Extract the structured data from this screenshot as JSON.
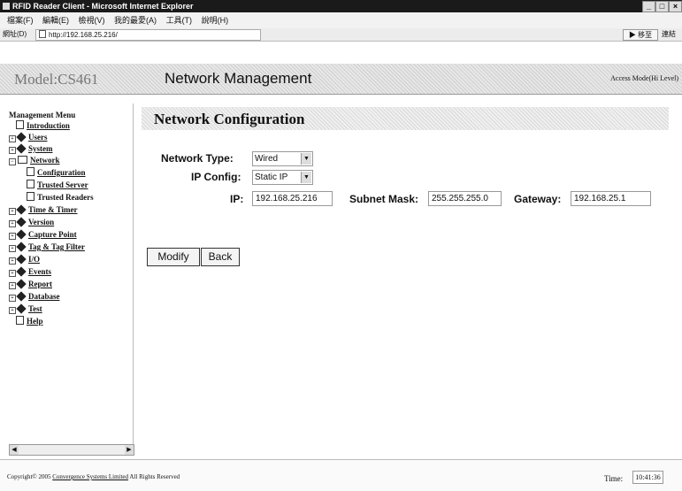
{
  "window": {
    "title": "RFID Reader Client - Microsoft Internet Explorer"
  },
  "menu": {
    "items": [
      "檔案(F)",
      "編輯(E)",
      "檢視(V)",
      "我的最愛(A)",
      "工具(T)",
      "說明(H)"
    ]
  },
  "address_bar": {
    "label": "網址(D)",
    "url": "http://192.168.25.216/",
    "go_label": "移至",
    "links_label": "連結"
  },
  "header": {
    "model": "Model:CS461",
    "page_title": "Network Management",
    "access": "Access Mode(Hi Level)"
  },
  "sidebar": {
    "title": "Management Menu",
    "items": [
      {
        "label": "Introduction",
        "icon": "document-icon",
        "indent": 0
      },
      {
        "label": "Users",
        "icon": "diamond-icon",
        "indent": 0
      },
      {
        "label": "System",
        "icon": "diamond-icon",
        "indent": 0
      },
      {
        "label": "Network",
        "icon": "folder-icon",
        "indent": 0
      },
      {
        "label": "Configuration",
        "icon": "document-icon",
        "indent": 1
      },
      {
        "label": "Trusted Server",
        "icon": "document-icon",
        "indent": 1
      },
      {
        "label": "Trusted Readers",
        "icon": "document-icon",
        "indent": 1
      },
      {
        "label": "Time & Timer",
        "icon": "diamond-icon",
        "indent": 0
      },
      {
        "label": "Version",
        "icon": "diamond-icon",
        "indent": 0
      },
      {
        "label": "Capture Point",
        "icon": "diamond-icon",
        "indent": 0
      },
      {
        "label": "Tag & Tag Filter",
        "icon": "diamond-icon",
        "indent": 0
      },
      {
        "label": "I/O",
        "icon": "diamond-icon",
        "indent": 0
      },
      {
        "label": "Events",
        "icon": "diamond-icon",
        "indent": 0
      },
      {
        "label": "Report",
        "icon": "diamond-icon",
        "indent": 0
      },
      {
        "label": "Database",
        "icon": "diamond-icon",
        "indent": 0
      },
      {
        "label": "Test",
        "icon": "diamond-icon",
        "indent": 0
      },
      {
        "label": "Help",
        "icon": "document-icon",
        "indent": 0
      }
    ]
  },
  "main": {
    "section_title": "Network Configuration",
    "network_type_label": "Network Type:",
    "network_type_value": "Wired",
    "ip_config_label": "IP Config:",
    "ip_config_value": "Static IP",
    "ip_label": "IP:",
    "ip_value": "192.168.25.216",
    "subnet_label": "Subnet Mask:",
    "subnet_value": "255.255.255.0",
    "gateway_label": "Gateway:",
    "gateway_value": "192.168.25.1",
    "modify_label": "Modify",
    "back_label": "Back"
  },
  "footer": {
    "copyright_prefix": "Copyright© 2005",
    "company": "Convergence Systems Limited",
    "rights": "All Rights Reserved",
    "time_label": "Time:",
    "time_value": "10:41:36"
  }
}
